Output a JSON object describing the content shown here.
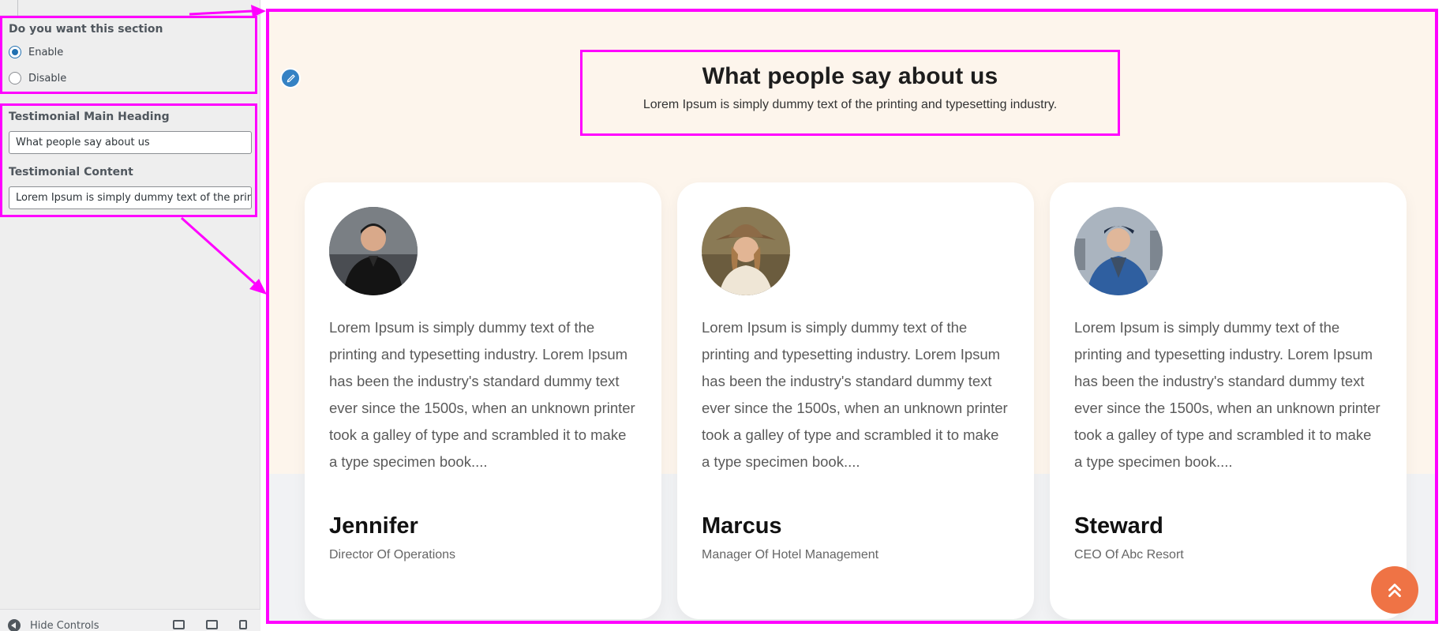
{
  "panel": {
    "section_toggle": {
      "title": "Do you want this section",
      "options": [
        {
          "label": "Enable",
          "selected": true
        },
        {
          "label": "Disable",
          "selected": false
        }
      ]
    },
    "heading_field": {
      "label": "Testimonial Main Heading",
      "value": "What people say about us"
    },
    "content_field": {
      "label": "Testimonial Content",
      "value": "Lorem Ipsum is simply dummy text of the prin"
    },
    "footer": {
      "hide_controls_label": "Hide Controls",
      "device_icons": [
        "desktop-icon",
        "tablet-icon",
        "mobile-icon"
      ]
    }
  },
  "preview": {
    "heading": "What people say about us",
    "subheading": "Lorem Ipsum is simply dummy text of the printing and typesetting industry.",
    "edit_icon": "pencil-icon",
    "testimonials": [
      {
        "quote": "Lorem Ipsum is simply dummy text of the printing and typesetting industry. Lorem Ipsum has been the industry's standard dummy text ever since the 1500s, when an unknown printer took a galley of type and scrambled it to make a type specimen book....",
        "name": "Jennifer",
        "role": "Director Of Operations"
      },
      {
        "quote": "Lorem Ipsum is simply dummy text of the printing and typesetting industry. Lorem Ipsum has been the industry's standard dummy text ever since the 1500s, when an unknown printer took a galley of type and scrambled it to make a type specimen book....",
        "name": "Marcus",
        "role": "Manager Of Hotel Management"
      },
      {
        "quote": "Lorem Ipsum is simply dummy text of the printing and typesetting industry. Lorem Ipsum has been the industry's standard dummy text ever since the 1500s, when an unknown printer took a galley of type and scrambled it to make a type specimen book....",
        "name": "Steward",
        "role": "CEO Of Abc Resort"
      }
    ],
    "scroll_top_icon": "double-chevron-up-icon"
  },
  "colors": {
    "highlight": "#ff00ff",
    "section_background": "#fdf5ec",
    "accent_button": "#ef7345",
    "wp_blue": "#2271b1"
  }
}
